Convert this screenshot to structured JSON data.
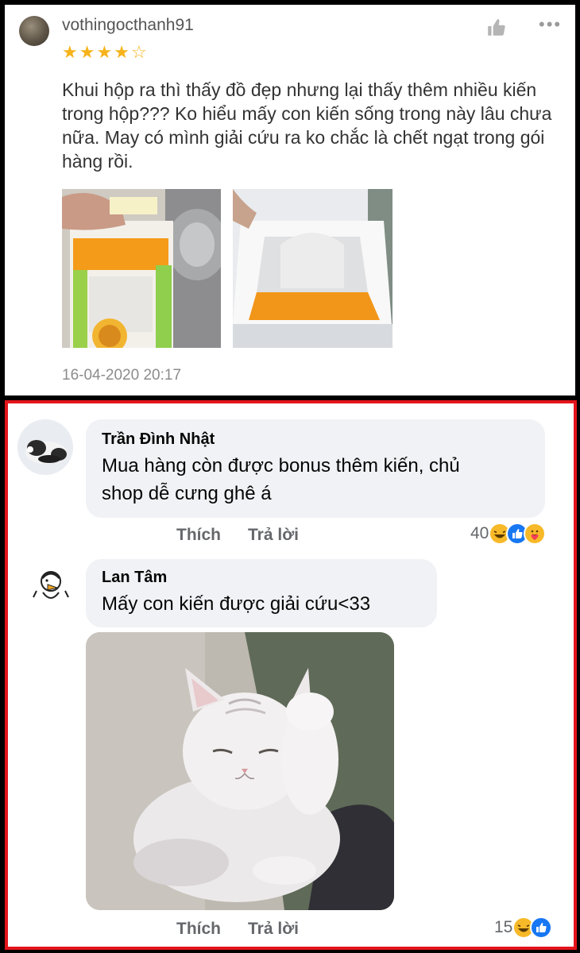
{
  "review": {
    "username": "vothingocthanh91",
    "rating": 4,
    "rating_max": 5,
    "more_icon": "more-horizontal-icon",
    "like_icon": "thumbs-up-icon",
    "text": "Khui hộp ra thì thấy đồ đẹp nhưng lại thấy thêm nhiều kiến trong hộp??? Ko hiểu mấy con kiến sống trong này lâu chưa nữa. May có mình giải cứu ra ko chắc là chết ngạt trong gói hàng rồi.",
    "date": "16-04-2020 20:17",
    "highlight_color": "#e4141b",
    "star_color": "#f6b31b"
  },
  "comments": [
    {
      "author": "Trần Đình Nhật",
      "text_lines": [
        "Mua hàng còn được bonus thêm kiến, chủ",
        "shop dễ cưng ghê á"
      ],
      "like_label": "Thích",
      "reply_label": "Trả lời",
      "reaction_count": "40",
      "reactions": [
        "haha-icon",
        "like-icon",
        "care-icon"
      ]
    },
    {
      "author": "Lan Tâm",
      "text_lines": [
        "Mấy con kiến được giải cứu<33"
      ],
      "like_label": "Thích",
      "reply_label": "Trả lời",
      "reaction_count": "15",
      "reactions": [
        "haha-icon",
        "like-icon"
      ],
      "attachment": "cat-gif"
    }
  ]
}
